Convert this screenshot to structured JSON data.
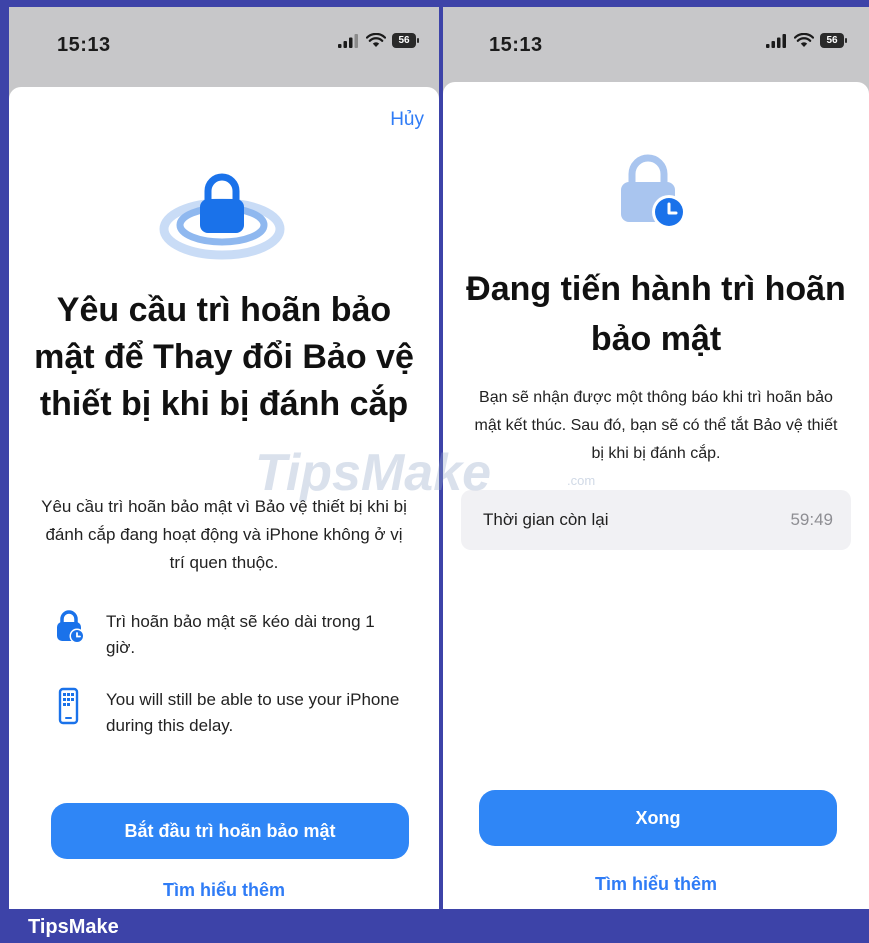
{
  "left_screen": {
    "status_time": "15:13",
    "battery": "56",
    "cancel_label": "Hủy",
    "title": "Yêu cầu trì hoãn bảo mật để Thay đổi Bảo vệ thiết bị khi bị đánh cắp",
    "subtitle": "Yêu cầu trì hoãn bảo mật vì Bảo vệ thiết bị khi bị đánh cắp đang hoạt động và iPhone không ở vị trí quen thuộc.",
    "features": [
      {
        "icon": "lock-clock-icon",
        "text": "Trì hoãn bảo mật sẽ kéo dài trong 1 giờ."
      },
      {
        "icon": "iphone-icon",
        "text": "You will still be able to use your iPhone during this delay."
      }
    ],
    "primary_button": "Bắt đầu trì hoãn bảo mật",
    "learn_more": "Tìm hiểu thêm"
  },
  "right_screen": {
    "status_time": "15:13",
    "battery": "56",
    "title": "Đang tiến hành trì hoãn bảo mật",
    "subtitle": "Bạn sẽ nhận được một thông báo khi trì hoãn bảo mật kết thúc. Sau đó, bạn sẽ có thể tắt Bảo vệ thiết bị khi bị đánh cắp.",
    "timer_label": "Thời gian còn lại",
    "timer_value": "59:49",
    "primary_button": "Xong",
    "learn_more": "Tìm hiểu thêm"
  },
  "watermark": {
    "name": "TipsMake",
    "suffix": ".com"
  },
  "brand_bar": {
    "label": "TipsMake"
  },
  "colors": {
    "accent": "#2f86f6",
    "frame": "#3d43a8",
    "status_bg": "#c7c7c9"
  }
}
